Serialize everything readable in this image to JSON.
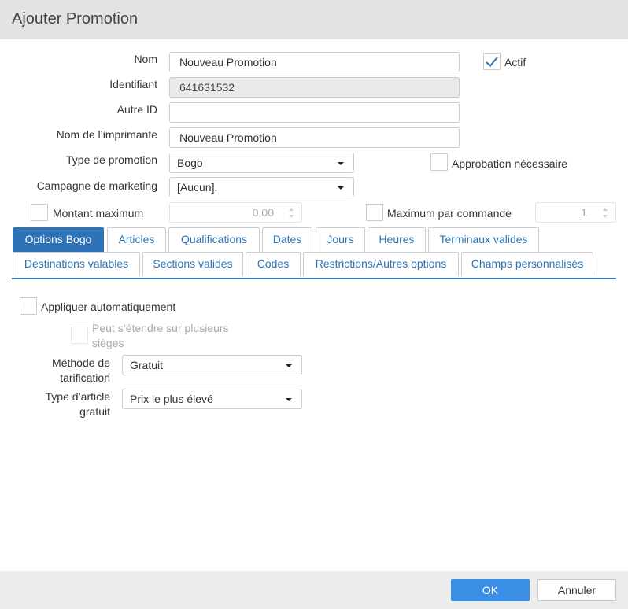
{
  "dialog": {
    "title": "Ajouter Promotion"
  },
  "form": {
    "nom": {
      "label": "Nom",
      "value": "Nouveau Promotion"
    },
    "actif": {
      "label": "Actif",
      "checked": true
    },
    "identifiant": {
      "label": "Identifiant",
      "value": "641631532"
    },
    "autre_id": {
      "label": "Autre ID",
      "value": ""
    },
    "nom_imprimante": {
      "label": "Nom de l’imprimante",
      "value": "Nouveau Promotion"
    },
    "type_promotion": {
      "label": "Type de promotion",
      "value": "Bogo"
    },
    "approbation": {
      "label": "Approbation nécessaire",
      "checked": false
    },
    "campagne": {
      "label": "Campagne de marketing",
      "value": "[Aucun]."
    },
    "montant_max": {
      "label": "Montant maximum",
      "checked": false,
      "value": "0,00"
    },
    "max_commande": {
      "label": "Maximum par commande",
      "checked": false,
      "value": "1"
    }
  },
  "tabs": [
    {
      "label": "Options Bogo",
      "active": true
    },
    {
      "label": "Articles"
    },
    {
      "label": "Qualifications"
    },
    {
      "label": "Dates"
    },
    {
      "label": "Jours"
    },
    {
      "label": "Heures"
    },
    {
      "label": "Terminaux valides"
    },
    {
      "label": "Destinations valables"
    },
    {
      "label": "Sections valides"
    },
    {
      "label": "Codes"
    },
    {
      "label": "Restrictions/Autres options"
    },
    {
      "label": "Champs personnalisés"
    }
  ],
  "bogo": {
    "appliquer_auto": {
      "label": "Appliquer automatiquement",
      "checked": false
    },
    "plusieurs_sieges": {
      "label": "Peut s’étendre sur plusieurs sièges",
      "checked": false,
      "disabled": true
    },
    "methode": {
      "label_line1": "Méthode de",
      "label_line2": "tarification",
      "value": "Gratuit"
    },
    "type_article": {
      "label_line1": "Type d’article",
      "label_line2": "gratuit",
      "value": "Prix le plus élevé"
    }
  },
  "footer": {
    "ok_label": "OK",
    "cancel_label": "Annuler"
  },
  "colors": {
    "accent": "#2e73b8",
    "ok_button": "#3a8ee6",
    "titlebar": "#e3e3e3"
  }
}
